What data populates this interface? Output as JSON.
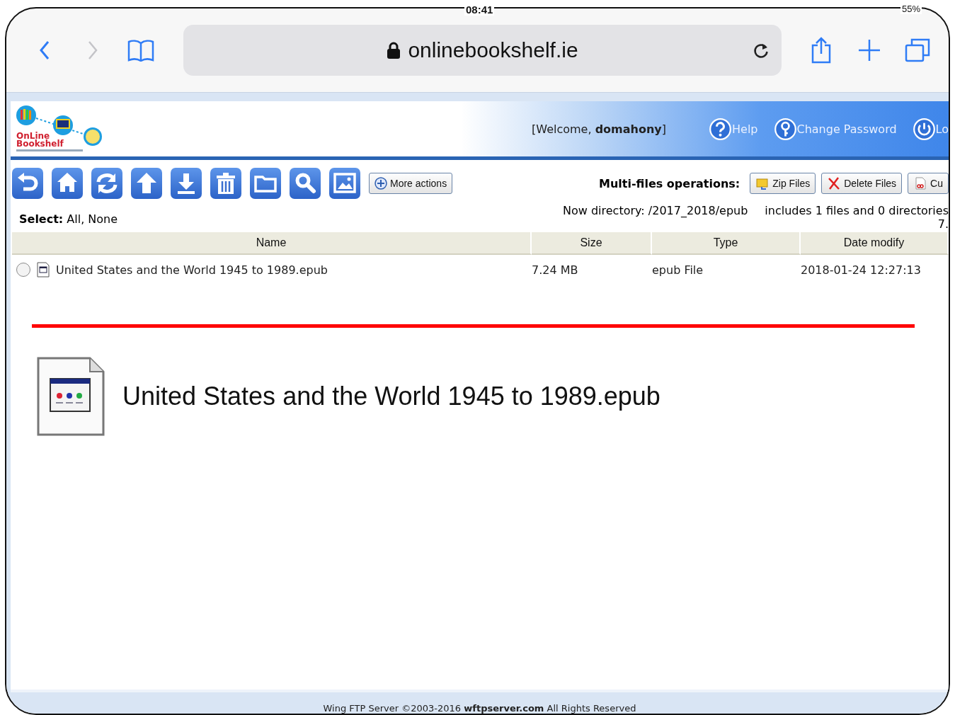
{
  "status_bar": {
    "time": "08:41",
    "battery": "55%"
  },
  "browser": {
    "url": "onlinebookshelf.ie"
  },
  "header": {
    "logo": {
      "line1": "OnLine",
      "line2": "Bookshelf"
    },
    "welcome": "[Welcome, **domahony**]",
    "links": [
      {
        "label": "Help",
        "kind": "help"
      },
      {
        "label": "Change Password",
        "kind": "key"
      },
      {
        "label": "Lo",
        "kind": "power"
      }
    ]
  },
  "toolbar": {
    "tools": [
      {
        "kind": "back"
      },
      {
        "kind": "home"
      },
      {
        "kind": "refresh"
      },
      {
        "kind": "upload"
      },
      {
        "kind": "download"
      },
      {
        "kind": "delete"
      },
      {
        "kind": "folder"
      },
      {
        "kind": "search"
      },
      {
        "kind": "image"
      }
    ],
    "more_actions": "More actions"
  },
  "multi_files": {
    "label": "Multi-files operations:",
    "buttons": [
      {
        "label": "Zip Files",
        "kind": "zip"
      },
      {
        "label": "Delete Files",
        "kind": "delete"
      },
      {
        "label": "Cu",
        "kind": "cut"
      }
    ]
  },
  "select": "**Select:** All, None",
  "directory": "Now directory: /2017_2018/epub",
  "summary": "includes 1 files and 0 directories",
  "summary_2": "7.",
  "table": {
    "columns": [
      "Name",
      "Size",
      "Type",
      "Date modify"
    ],
    "rows": [
      {
        "checked": false,
        "name": "United States and the World 1945 to 1989.epub",
        "size": "7.24 MB",
        "type": "epub File",
        "date": "2018-01-24 12:27:13"
      }
    ]
  },
  "preview": {
    "name": "United States and the World 1945 to 1989.epub"
  },
  "footer": "Wing FTP Server ©2003-2016 **wftpserver.com** All Rights Reserved"
}
